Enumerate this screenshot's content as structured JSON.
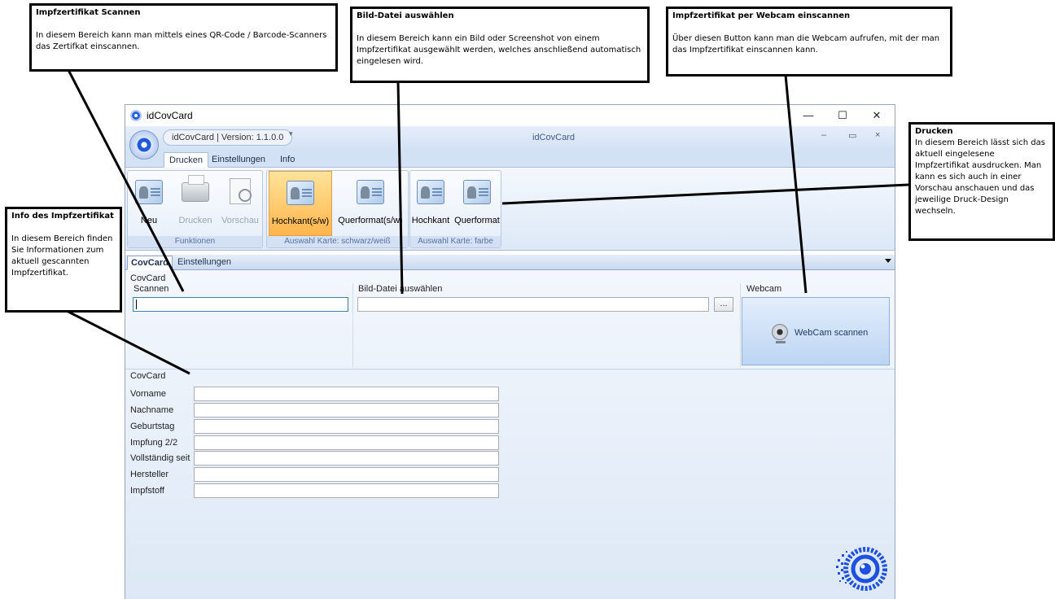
{
  "window": {
    "title": "idCovCard",
    "controls": {
      "minimize": "—",
      "maximize": "☐",
      "close": "✕"
    },
    "version_label": "idCovCard | Version: 1.1.0.0",
    "quick_dropdown": "▾",
    "center_title": "idCovCard",
    "inner_controls": {
      "minimize": "–",
      "restore": "▭",
      "close": "×"
    }
  },
  "ribbon": {
    "tabs": [
      {
        "label": "Drucken"
      },
      {
        "label": "Einstellungen"
      },
      {
        "label": "Info"
      }
    ],
    "groups": [
      {
        "caption": "Funktionen",
        "buttons": [
          {
            "label": "Neu"
          },
          {
            "label": "Drucken"
          },
          {
            "label": "Vorschau"
          }
        ]
      },
      {
        "caption": "Auswahl Karte: schwarz/weiß",
        "buttons": [
          {
            "label": "Hochkant(s/w)"
          },
          {
            "label": "Querformat(s/w)"
          }
        ]
      },
      {
        "caption": "Auswahl Karte: farbe",
        "buttons": [
          {
            "label": "Hochkant"
          },
          {
            "label": "Querformat"
          }
        ]
      }
    ]
  },
  "doc_tabs": [
    {
      "label": "CovCard"
    },
    {
      "label": "Einstellungen"
    }
  ],
  "scan": {
    "group_title": "CovCard",
    "scan_label": "Scannen",
    "scan_value": "",
    "file_label": "Bild-Datei auswählen",
    "file_value": "",
    "browse_label": "...",
    "webcam_label": "Webcam",
    "webcam_button": "WebCam scannen"
  },
  "info": {
    "group_title": "CovCard",
    "fields": [
      {
        "label": "Vorname",
        "value": ""
      },
      {
        "label": "Nachname",
        "value": ""
      },
      {
        "label": "Geburtstag",
        "value": ""
      },
      {
        "label": "Impfung 2/2",
        "value": ""
      },
      {
        "label": "Vollständig seit",
        "value": ""
      },
      {
        "label": "Hersteller",
        "value": ""
      },
      {
        "label": "Impfstoff",
        "value": ""
      }
    ]
  },
  "callouts": {
    "scannen": {
      "title": "Impfzertifikat Scannen",
      "text": "In diesem Bereich kann man mittels eines QR-Code / Barcode-Scanners das Zertifkat einscannen."
    },
    "bilddatei": {
      "title": "Bild-Datei auswählen",
      "text": "In diesem Bereich kann ein Bild oder Screenshot von einem Impfzertifikat ausgewählt werden, welches anschließend automatisch eingelesen wird."
    },
    "webcam": {
      "title": "Impfzertifikat per Webcam einscannen",
      "text": "Über diesen Button kann man die Webcam aufrufen, mit der man das Impfzertifikat einscannen kann."
    },
    "drucken": {
      "title": "Drucken",
      "text": "In diesem Bereich lässt sich das aktuell eingelesene Impfzertifikat ausdrucken. Man kann es sich auch in einer Vorschau anschauen und das jeweilige Druck-Design wechseln."
    },
    "info": {
      "title": "Info des Impfzertifikat",
      "text": "In diesem Bereich finden Sie Informationen zum aktuell gescannten Impfzertifikat."
    }
  },
  "colors": {
    "accent": "#2563d9",
    "ribbon_bg": "#dde8f7",
    "highlight": "#ffb54c",
    "content_bg": "#e8f0fa"
  }
}
